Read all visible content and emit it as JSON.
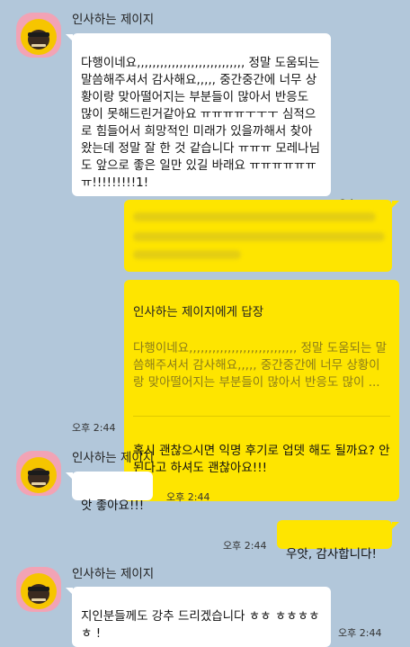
{
  "sender": "인사하는 제이지",
  "messages": [
    {
      "text": "다행이네요,,,,,,,,,,,,,,,,,,,,,,,,,,,, 정말 도움되는 말씀해주셔서 감사해요,,,,, 중간중간에 너무 상황이랑 맞아떨어지는 부분들이 많아서 반응도 많이 못해드린거같아요 ㅠㅠㅠㅠㅜㅜㅜ 심적으로 힘들어서 희망적인 미래가 있을까해서 찾아왔는데 정말 잘 한 것 같습니다 ㅠㅠㅠ 모레나님도 앞으로 좋은 일만 있길 바래요 ㅠㅠㅠㅠㅠㅠㅠ!!!!!!!!!1!",
      "time": "오후 2:43"
    },
    {
      "reply_title": "인사하는 제이지에게 답장",
      "reply_quote": "다행이네요,,,,,,,,,,,,,,,,,,,,,,,,,,,, 정말 도움되는 말씀해주셔서 감사해요,,,,, 중간중간에 너무 상황이랑 맞아떨어지는 부분들이 많아서 반응도 많이 ...",
      "text": "혹시 괜찮으시면 익명 후기로 업뎃 해도 될까요? 안 된다고 하셔도 괜찮아요!!!",
      "time": "오후 2:44"
    },
    {
      "text": "앗 좋아요!!!",
      "time": "오후 2:44"
    },
    {
      "text": "우앗, 감사합니다!",
      "time": "오후 2:44"
    },
    {
      "text": "지인분들께도 강추 드리겠습니다 ㅎㅎ ㅎㅎㅎㅎㅎ !",
      "time": "오후 2:44"
    }
  ],
  "colors": {
    "background": "#b2c7da",
    "outgoing_bubble": "#fee500",
    "incoming_bubble": "#ffffff",
    "avatar_bg": "#f2a3b5"
  },
  "icons": {
    "avatar": "character-avatar-icon"
  }
}
